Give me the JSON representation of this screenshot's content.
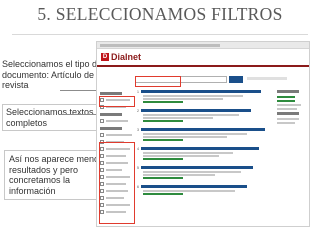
{
  "slide": {
    "title": "5. SELECCIONAMOS FILTROS",
    "notes": {
      "tipo_documento": "Seleccionamos el tipo de documento: Artículo de revista",
      "textos_completos": "Seleccionamos textos completos",
      "resultados": "Así nos aparece menos resultados y pero concretamos la información"
    }
  },
  "screenshot": {
    "logo_text": "Dialnet",
    "colors": {
      "brand_red": "#c0151b",
      "link_blue": "#1a4f8a",
      "link_green": "#2e8b3e",
      "highlight": "#e03b2e"
    }
  }
}
